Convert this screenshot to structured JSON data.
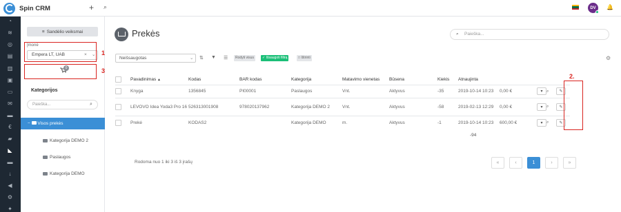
{
  "app": {
    "name": "Spin CRM",
    "plus": "+",
    "user_initials": "DV"
  },
  "left_nav_icons": [
    "dashboard-icon",
    "rss-icon",
    "globe-icon",
    "document-icon",
    "pages-icon",
    "briefcase-icon",
    "inbox-icon",
    "mail-icon",
    "chat-icon",
    "euro-icon",
    "truck-icon",
    "cart-icon",
    "folder-icon",
    "download-icon",
    "megaphone-icon",
    "gear-icon",
    "tools-icon"
  ],
  "side": {
    "warehouse_button": "Sandėlio veiksmai",
    "company_label": "Įmonė",
    "company_value": "Empera LT, UAB",
    "company_clear": "×",
    "cart_badge": "0",
    "categories_title": "Kategorijos",
    "categories_search_placeholder": "Paieška...",
    "tree": {
      "root": "Visos prekės",
      "children": [
        "Kategorija DEMO 2",
        "Paslaugos",
        "Kategorija DEMO"
      ]
    }
  },
  "annotations": {
    "one": "1.",
    "two": "2.",
    "three": "3."
  },
  "main": {
    "title": "Prekės",
    "search_placeholder": "Paieška...",
    "saved_filter": "Neišsaugotas",
    "show_all": "Rodyti visus",
    "save_filter": "Išsaugoti filtrą",
    "delete": "Ištrinti",
    "columns": [
      "Pavadinimas",
      "Kodas",
      "BAR kodas",
      "Kategorija",
      "Matavimo vienetas",
      "Būsena",
      "Kiekis",
      "Atnaujinta"
    ],
    "sort_arrow": "▲",
    "rows": [
      {
        "name": "Knyga",
        "code": "1356845",
        "bar": "PI00001",
        "category": "Paslaugos",
        "unit": "Vnt.",
        "status": "Aktyvus",
        "qty": "-35",
        "updated": "2019-10-14 10:23",
        "price": "0,00 €"
      },
      {
        "name": "LEVOVO Idea Yoda3 Pro 16",
        "code": "526313001908",
        "bar": "978020137962",
        "category": "Kategorija DEMO 2",
        "unit": "Vnt.",
        "status": "Aktyvus",
        "qty": "-58",
        "updated": "2019-02-13 12:29",
        "price": "0,00 €"
      },
      {
        "name": "Prekė",
        "code": "KODAS2",
        "bar": "",
        "category": "Kategorija DEMO",
        "unit": "m.",
        "status": "Aktyvus",
        "qty": "-1",
        "updated": "2019-10-14 10:23",
        "price": "600,00 €"
      }
    ],
    "qty_total": "-94",
    "showing": "Rodoma nuo 1 iki 3 iš 3 įrašų",
    "pagination": [
      "«",
      "‹",
      "1",
      "›",
      "»"
    ],
    "current_page": "1"
  },
  "colors": {
    "accent": "#3b8fd6",
    "highlight": "#d9231f",
    "nav_bg": "#1e2833",
    "save_green": "#1bbf78"
  }
}
